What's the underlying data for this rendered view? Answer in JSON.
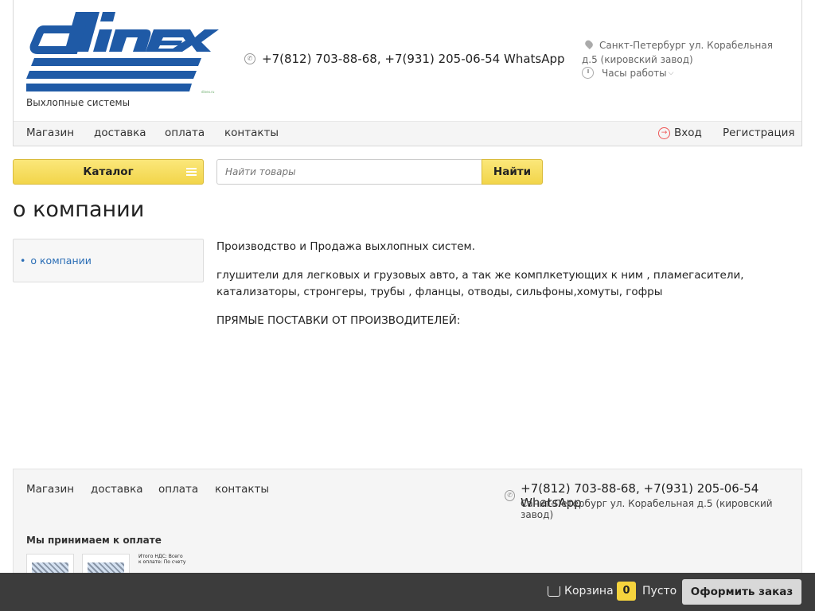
{
  "header": {
    "logo_text": "DINEX",
    "logo_subtitle": "Выхлопные системы",
    "phone": "+7(812) 703-88-68, +7(931) 205-06-54 WhatsApp",
    "address": "Санкт-Петербург ул. Корабельная д.5 (кировский завод)",
    "hours_label": "Часы работы"
  },
  "nav": {
    "items": [
      "Магазин",
      "доставка",
      "оплата",
      "контакты"
    ],
    "login_label": "Вход",
    "register_label": "Регистрация"
  },
  "catalog": {
    "label": "Каталог"
  },
  "search": {
    "placeholder": "Найти товары",
    "button_label": "Найти"
  },
  "page": {
    "title": "о компании",
    "sidebar_items": [
      "о компании"
    ],
    "paragraphs": [
      "Производство и Продажа выхлопных систем.",
      "глушители для легковых и грузовых авто, а так же комплкетующих к ним , пламегасители, катализаторы, стронгеры, трубы , фланцы, отводы, сильфоны,хомуты, гофры",
      "ПРЯМЫЕ ПОСТАВКИ ОТ ПРОИЗВОДИТЕЛЕЙ:"
    ]
  },
  "footer": {
    "nav_items": [
      "Магазин",
      "доставка",
      "оплата",
      "контакты"
    ],
    "phone": "+7(812) 703-88-68, +7(931) 205-06-54 WhatsApp",
    "address": "Санкт-Петербург ул. Корабельная д.5 (кировский завод)",
    "payment_title": "Мы принимаем к оплате",
    "invoice_text": "Итого НДС: Всего к оплате: По счету"
  },
  "cart": {
    "label": "Корзина",
    "count": "0",
    "state": "Пусто",
    "checkout_label": "Оформить заказ"
  },
  "colors": {
    "accent_yellow": "#f5d33d",
    "brand_blue": "#1f5aa6",
    "link_blue": "#2a6db5",
    "cart_bar": "#3c3c3c"
  }
}
